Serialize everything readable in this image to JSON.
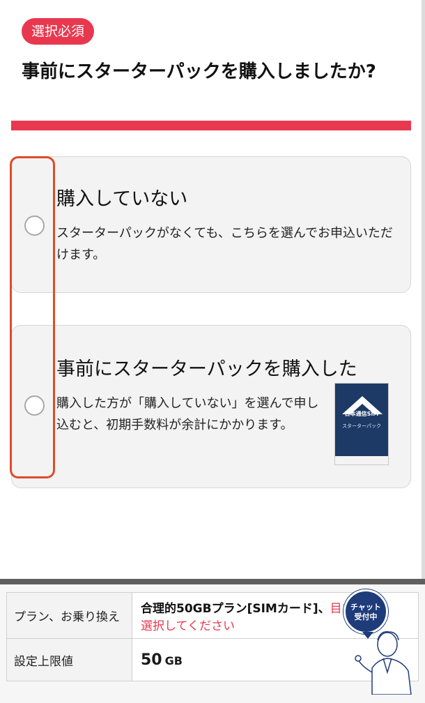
{
  "badge": "選択必須",
  "question": "事前にスターターパックを購入しましたか?",
  "options": [
    {
      "title": "購入していない",
      "description": "スターターパックがなくても、こちらを選んでお申込いただけます。"
    },
    {
      "title": "事前にスターターパックを購入した",
      "description": "購入した方が「購入していない」を選んで申し込むと、初期手数料が余計にかかります。",
      "image_label": "日本通信SIM",
      "image_sublabel": "スターターパック"
    }
  ],
  "summary": {
    "plan_label": "プラン、お乗り換え",
    "plan_value": "合理的50GBプラン[SIMカード]、",
    "plan_note_end": "目を",
    "plan_note": "選択してください",
    "limit_label": "設定上限値",
    "limit_value": "50",
    "limit_unit": "GB"
  },
  "chat": {
    "label_line1": "チャット",
    "label_line2": "受付中"
  },
  "colors": {
    "accent": "#e8384f",
    "highlight": "#e04a2a",
    "chat": "#1e3b7a"
  }
}
